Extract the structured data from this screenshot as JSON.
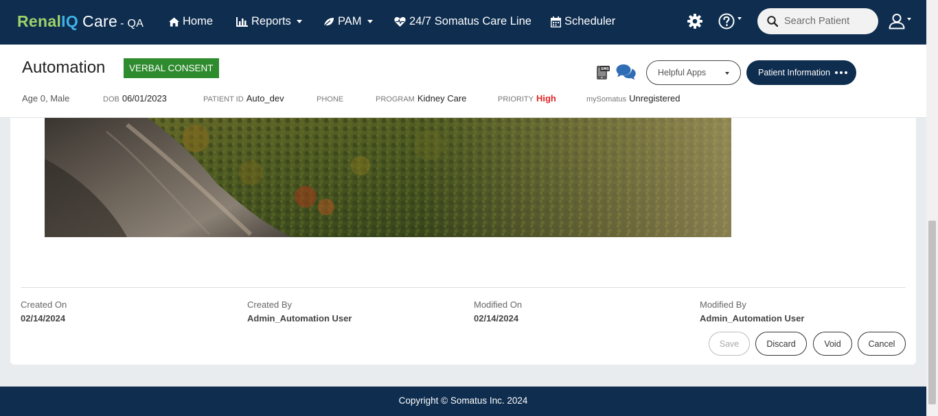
{
  "nav": {
    "brand": {
      "part1": "Renal",
      "part2": "IQ",
      "part3": "Care",
      "env": "- QA"
    },
    "items": [
      {
        "label": "Home",
        "icon": "home-icon"
      },
      {
        "label": "Reports",
        "icon": "bar-chart-icon",
        "dropdown": true
      },
      {
        "label": "PAM",
        "icon": "leaf-icon",
        "dropdown": true
      },
      {
        "label": "24/7 Somatus Care Line",
        "icon": "heartbeat-icon"
      },
      {
        "label": "Scheduler",
        "icon": "calendar-icon"
      }
    ],
    "search_placeholder": "Search Patient",
    "colors": {
      "bar": "#0e2d4f",
      "brand_green": "#9ed36a",
      "brand_blue": "#3fb2e8"
    }
  },
  "patient": {
    "name": "Automation",
    "consent_badge": "VERBAL CONSENT",
    "helpful_apps": "Helpful Apps",
    "info_button": "Patient Information",
    "meta": {
      "age_sex": "Age 0, Male",
      "dob_label": "DOB",
      "dob": "06/01/2023",
      "patient_id_label": "PATIENT ID",
      "patient_id": "Auto_dev",
      "phone_label": "PHONE",
      "phone": "",
      "program_label": "PROGRAM",
      "program": "Kidney Care",
      "priority_label": "PRIORITY",
      "priority": "High",
      "mysomatus_label": "mySomatus",
      "mysomatus": "Unregistered"
    }
  },
  "record": {
    "created_on_label": "Created On",
    "created_on": "02/14/2024",
    "created_by_label": "Created By",
    "created_by": "Admin_Automation User",
    "modified_on_label": "Modified On",
    "modified_on": "02/14/2024",
    "modified_by_label": "Modified By",
    "modified_by": "Admin_Automation User"
  },
  "actions": {
    "save": "Save",
    "discard": "Discard",
    "void": "Void",
    "cancel": "Cancel"
  },
  "footer": {
    "copyright": "Copyright © Somatus Inc. 2024"
  }
}
